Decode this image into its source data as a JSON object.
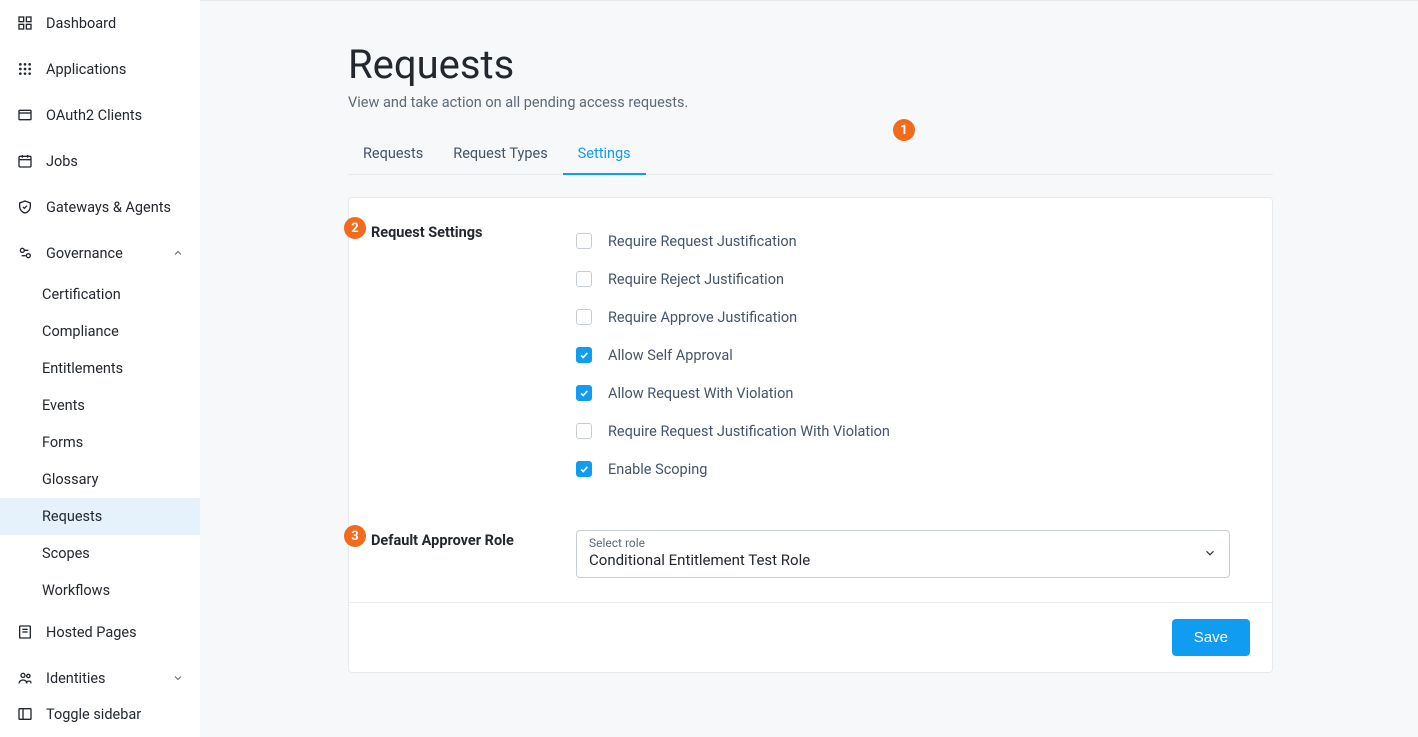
{
  "sidebar": {
    "dashboard": "Dashboard",
    "applications": "Applications",
    "oauth2_clients": "OAuth2 Clients",
    "jobs": "Jobs",
    "gateways": "Gateways & Agents",
    "governance": "Governance",
    "gov_items": {
      "certification": "Certification",
      "compliance": "Compliance",
      "entitlements": "Entitlements",
      "events": "Events",
      "forms": "Forms",
      "glossary": "Glossary",
      "requests": "Requests",
      "scopes": "Scopes",
      "workflows": "Workflows"
    },
    "hosted_pages": "Hosted Pages",
    "identities": "Identities",
    "toggle_sidebar": "Toggle sidebar"
  },
  "page": {
    "title": "Requests",
    "desc": "View and take action on all pending access requests."
  },
  "tabs": {
    "requests": "Requests",
    "request_types": "Request Types",
    "settings": "Settings"
  },
  "callouts": {
    "c1": "1",
    "c2": "2",
    "c3": "3"
  },
  "settings_section": {
    "heading": "Request Settings",
    "items": {
      "require_request_just": "Require Request Justification",
      "require_reject_just": "Require Reject Justification",
      "require_approve_just": "Require Approve Justification",
      "allow_self_approval": "Allow Self Approval",
      "allow_req_violation": "Allow Request With Violation",
      "require_req_just_violation": "Require Request Justification With Violation",
      "enable_scoping": "Enable Scoping"
    }
  },
  "approver": {
    "heading": "Default Approver Role",
    "float_label": "Select role",
    "value": "Conditional Entitlement Test Role"
  },
  "buttons": {
    "save": "Save"
  }
}
